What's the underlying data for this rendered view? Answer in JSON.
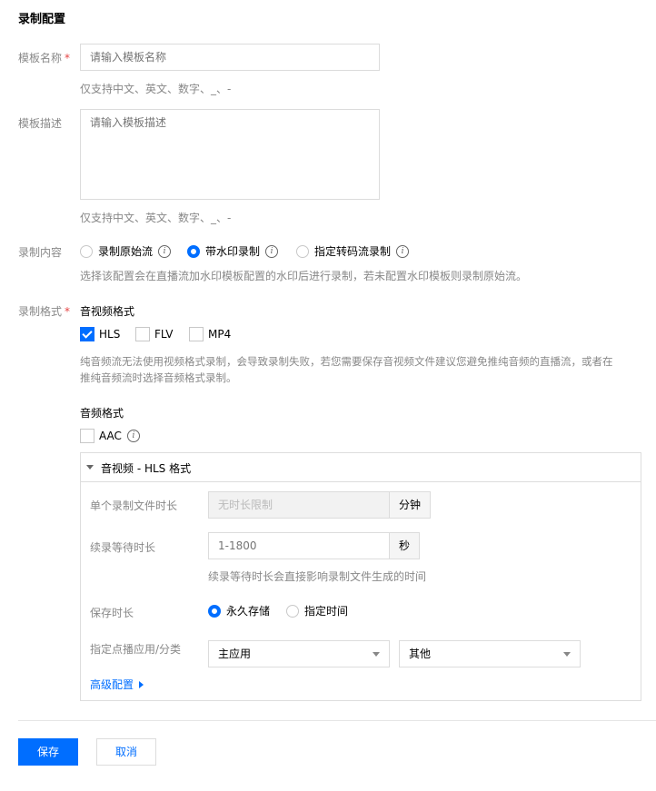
{
  "page": {
    "title": "录制配置"
  },
  "template_name": {
    "label": "模板名称",
    "required_mark": "*",
    "placeholder": "请输入模板名称",
    "hint": "仅支持中文、英文、数字、_、-"
  },
  "template_desc": {
    "label": "模板描述",
    "placeholder": "请输入模板描述",
    "hint": "仅支持中文、英文、数字、_、-"
  },
  "record_content": {
    "label": "录制内容",
    "options": [
      {
        "label": "录制原始流",
        "selected": false
      },
      {
        "label": "带水印录制",
        "selected": true
      },
      {
        "label": "指定转码流录制",
        "selected": false
      }
    ],
    "hint": "选择该配置会在直播流加水印模板配置的水印后进行录制，若未配置水印模板则录制原始流。"
  },
  "record_format": {
    "label": "录制格式",
    "required_mark": "*",
    "av_title": "音视频格式",
    "av_options": [
      {
        "label": "HLS",
        "checked": true
      },
      {
        "label": "FLV",
        "checked": false
      },
      {
        "label": "MP4",
        "checked": false
      }
    ],
    "av_hint_line1": "纯音频流无法使用视频格式录制，会导致录制失败，若您需要保存音视频文件建议您避免推纯音频的直播流，或者在",
    "av_hint_line2": "推纯音频流时选择音频格式录制。",
    "audio_title": "音频格式",
    "audio_options": [
      {
        "label": "AAC",
        "checked": false
      }
    ]
  },
  "hls_panel": {
    "title": "音视频 - HLS 格式",
    "file_duration": {
      "label": "单个录制文件时长",
      "value": "无时长限制",
      "unit": "分钟"
    },
    "continue_wait": {
      "label": "续录等待时长",
      "placeholder": "1-1800",
      "unit": "秒",
      "hint": "续录等待时长会直接影响录制文件生成的时间"
    },
    "retention": {
      "label": "保存时长",
      "options": [
        {
          "label": "永久存储",
          "selected": true
        },
        {
          "label": "指定时间",
          "selected": false
        }
      ]
    },
    "vod_app": {
      "label": "指定点播应用/分类",
      "app_value": "主应用",
      "category_value": "其他"
    },
    "advanced_label": "高级配置"
  },
  "actions": {
    "save": "保存",
    "cancel": "取消"
  },
  "colors": {
    "primary": "#006eff",
    "required": "#e54545",
    "hint": "#888888"
  }
}
